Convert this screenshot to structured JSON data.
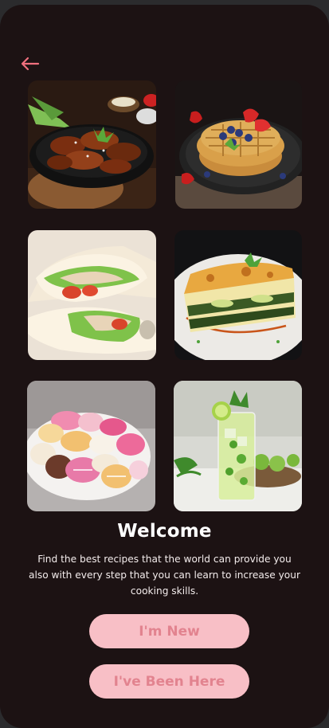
{
  "nav": {
    "back_icon": "arrow-left-icon",
    "accent": "#f0707e"
  },
  "gallery": [
    {
      "name": "spicy-chicken-wings"
    },
    {
      "name": "berry-waffles"
    },
    {
      "name": "chicken-wraps"
    },
    {
      "name": "vegetable-lasagna"
    },
    {
      "name": "macarons"
    },
    {
      "name": "mojito-drink"
    }
  ],
  "welcome": {
    "title": "Welcome",
    "description": "Find the best recipes that the world can provide you also with every step that you can learn to increase your cooking skills."
  },
  "buttons": {
    "new_label": "I'm New",
    "returning_label": "I've Been Here"
  },
  "colors": {
    "background": "#1c1213",
    "button_bg": "#f8bfc6",
    "button_text": "#e2838f"
  }
}
